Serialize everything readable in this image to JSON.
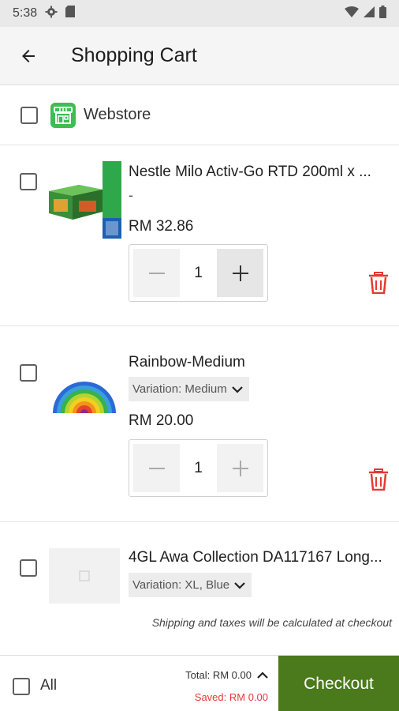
{
  "status_bar": {
    "time": "5:38"
  },
  "app_bar": {
    "title": "Shopping Cart"
  },
  "store": {
    "name": "Webstore"
  },
  "items": [
    {
      "name": "Nestle Milo Activ-Go RTD  200ml x ...",
      "subline": "-",
      "price": "RM 32.86",
      "quantity": "1"
    },
    {
      "name": "Rainbow-Medium",
      "variation": "Variation: Medium",
      "price": "RM 20.00",
      "quantity": "1"
    },
    {
      "name": "4GL Awa Collection DA117167 Long...",
      "variation": "Variation: XL, Blue"
    }
  ],
  "shipping_note": "Shipping and taxes will be calculated at checkout",
  "bottom_bar": {
    "all_label": "All",
    "total": "Total: RM 0.00",
    "saved": "Saved: RM 0.00",
    "checkout_label": "Checkout"
  },
  "colors": {
    "accent": "#4a7a1c",
    "danger": "#e53935",
    "store_icon": "#3dbd54"
  }
}
